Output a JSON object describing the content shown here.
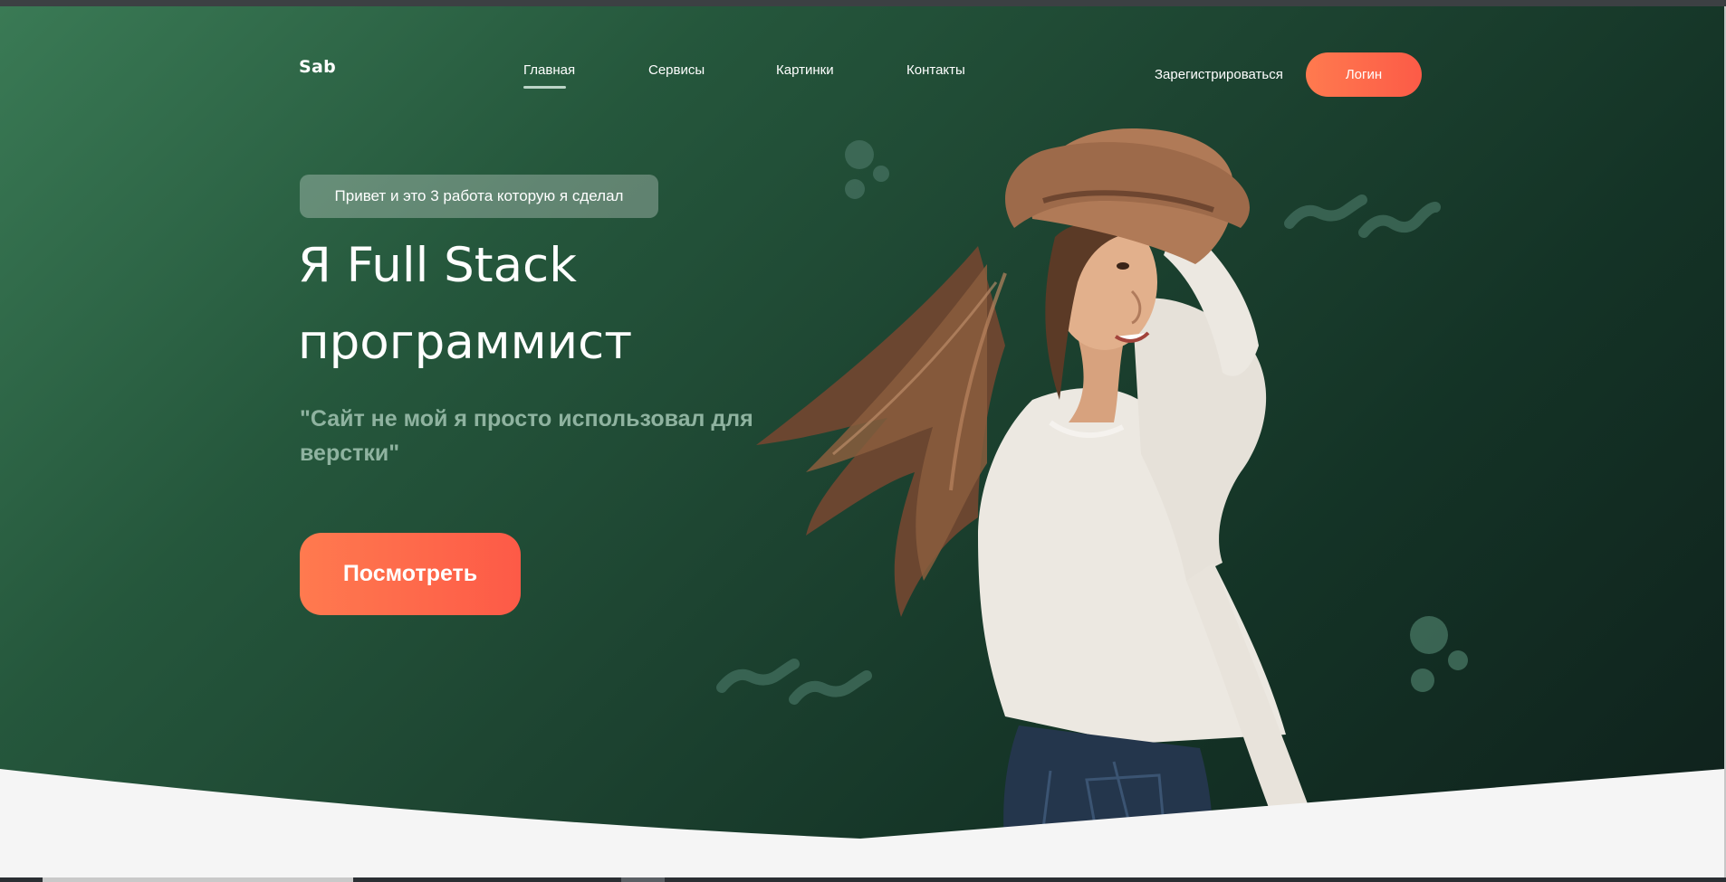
{
  "brand": {
    "logo": "Sab"
  },
  "nav": {
    "items": [
      {
        "label": "Главная",
        "active": true
      },
      {
        "label": "Сервисы",
        "active": false
      },
      {
        "label": "Картинки",
        "active": false
      },
      {
        "label": "Контакты",
        "active": false
      }
    ],
    "register_label": "Зарегистрироваться",
    "login_label": "Логин"
  },
  "hero": {
    "badge": "Привет и это 3 работа которую я сделал",
    "headline_line1": "Я Full Stack",
    "headline_line2": "программист",
    "quote": "\"Сайт не мой я просто использовал для верстки\"",
    "cta_label": "Посмотреть"
  },
  "colors": {
    "accent": "#fd6a4b",
    "hero_bg_start": "#3a7a55",
    "hero_bg_end": "#0f211c",
    "quote_text": "#8fb3a0",
    "page_bg": "#f5f5f5"
  }
}
